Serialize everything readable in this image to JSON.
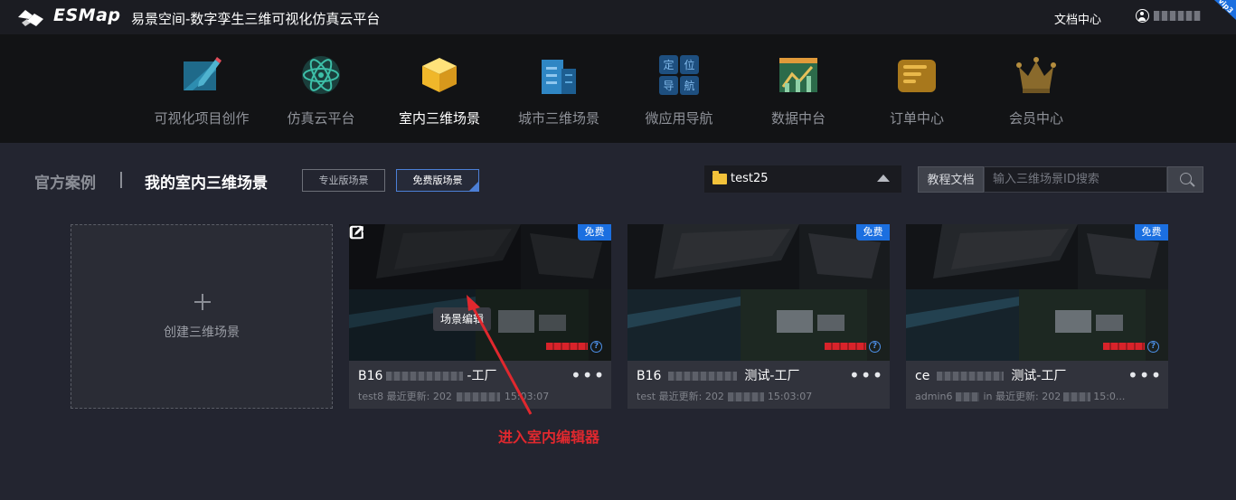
{
  "header": {
    "brand": "ESMap",
    "site_title": "易景空间-数字孪生三维可视化仿真云平台",
    "doc_center": "文档中心",
    "vip_label": "vip3"
  },
  "nav": {
    "items": [
      {
        "label": "可视化项目创作",
        "icon": "pencil-board-icon"
      },
      {
        "label": "仿真云平台",
        "icon": "atom-icon"
      },
      {
        "label": "室内三维场景",
        "icon": "cube-icon"
      },
      {
        "label": "城市三维场景",
        "icon": "building-icon"
      },
      {
        "label": "微应用导航",
        "icon": "navigation-grid-icon",
        "grid_chars": [
          "定",
          "位",
          "导",
          "航"
        ]
      },
      {
        "label": "数据中台",
        "icon": "chart-icon"
      },
      {
        "label": "订单中心",
        "icon": "order-icon"
      },
      {
        "label": "会员中心",
        "icon": "crown-icon"
      }
    ],
    "active_index": 2
  },
  "toolbar": {
    "tab_official": "官方案例",
    "tab_mine": "我的室内三维场景",
    "btn_pro": "专业版场景",
    "btn_free": "免费版场景",
    "folder": "test25",
    "tutorial": "教程文档",
    "search_placeholder": "输入三维场景ID搜索"
  },
  "create_card": {
    "label": "创建三维场景"
  },
  "scenes": [
    {
      "badge": "免费",
      "name_prefix": "B16",
      "name_suffix": "-工厂",
      "meta_prefix": "test8 最近更新: 202",
      "meta_suffix": "15:03:07"
    },
    {
      "badge": "免费",
      "name_prefix": "B16",
      "name_suffix": "测试-工厂",
      "meta_prefix": "test 最近更新: 202",
      "meta_suffix": "15:03:07"
    },
    {
      "badge": "免费",
      "name_prefix": "ce",
      "name_suffix": "测试-工厂",
      "meta_prefix": "admin6",
      "meta_mid": "in 最近更新: 202",
      "meta_suffix": "15:0..."
    }
  ],
  "hover": {
    "tooltip": "场景编辑"
  },
  "annotation": "进入室内编辑器",
  "colors": {
    "accent_blue": "#1b6fe0",
    "annotation_red": "#e0282e",
    "folder_yellow": "#f2c23a"
  }
}
